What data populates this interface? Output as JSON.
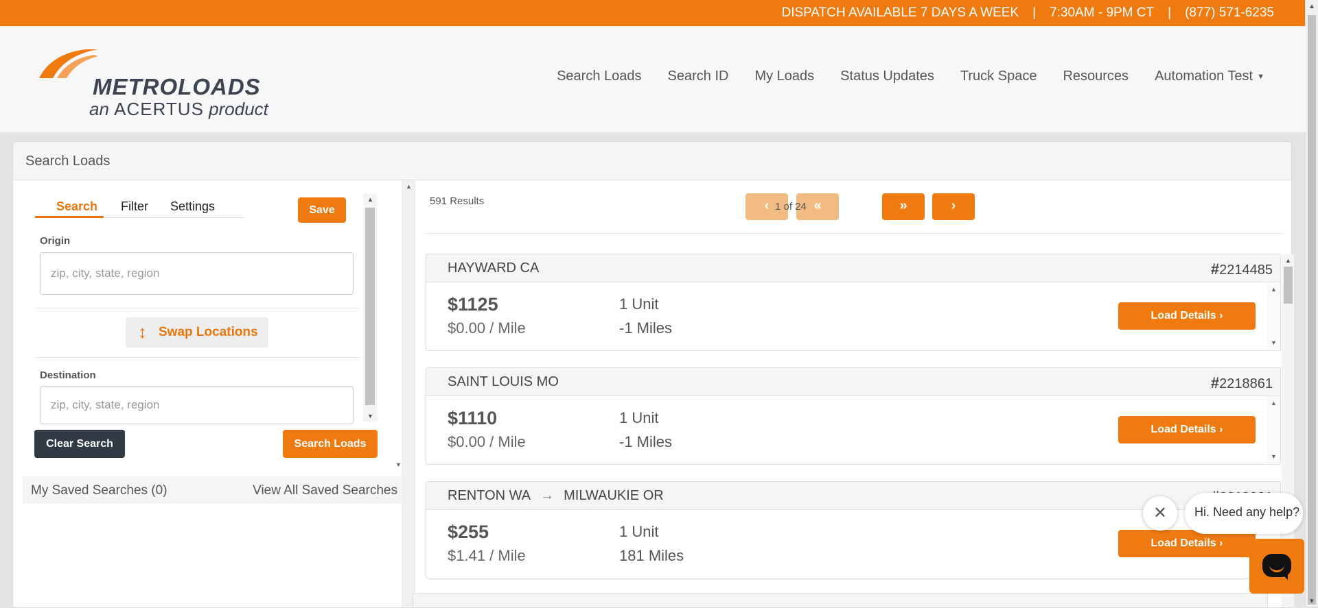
{
  "topbar": {
    "dispatch": "DISPATCH AVAILABLE 7 DAYS A WEEK",
    "sep": "|",
    "hours": "7:30AM - 9PM CT",
    "phone": "(877) 571-6235"
  },
  "logo": {
    "brand": "METROLOADS",
    "tag_prefix": "an",
    "tag_company": "ACERTUS",
    "tag_suffix": "product"
  },
  "nav": {
    "items": [
      "Search Loads",
      "Search ID",
      "My Loads",
      "Status Updates",
      "Truck Space",
      "Resources",
      "Automation Test"
    ]
  },
  "panel": {
    "title": "Search Loads"
  },
  "search": {
    "tabs": [
      "Search",
      "Filter",
      "Settings"
    ],
    "save_label": "Save",
    "origin_label": "Origin",
    "origin_placeholder": "zip, city, state, region",
    "swap_label": "Swap Locations",
    "destination_label": "Destination",
    "destination_placeholder": "zip, city, state, region",
    "clear_label": "Clear Search",
    "search_label": "Search Loads"
  },
  "saved": {
    "label": "My Saved Searches (0)",
    "view_all": "View All Saved Searches"
  },
  "results": {
    "count": "591 Results",
    "page_text": "1 of 24",
    "load_details_label": "Load Details",
    "cards": [
      {
        "origin": "HAYWARD CA",
        "destination": "",
        "id": "2214485",
        "price": "$1125",
        "per_mile": "$0.00 / Mile",
        "units": "1 Unit",
        "miles": "-1 Miles"
      },
      {
        "origin": "SAINT LOUIS MO",
        "destination": "",
        "id": "2218861",
        "price": "$1110",
        "per_mile": "$0.00 / Mile",
        "units": "1 Unit",
        "miles": "-1 Miles"
      },
      {
        "origin": "RENTON WA",
        "destination": "MILWAUKIE OR",
        "id": "2219931",
        "price": "$255",
        "per_mile": "$1.41 / Mile",
        "units": "1 Unit",
        "miles": "181 Miles"
      }
    ]
  },
  "chat": {
    "prompt": "Hi. Need any help?"
  },
  "colors": {
    "accent": "#ee7a10",
    "dark_button": "#2f3a44",
    "disabled_page_button": "#f0bc82"
  }
}
